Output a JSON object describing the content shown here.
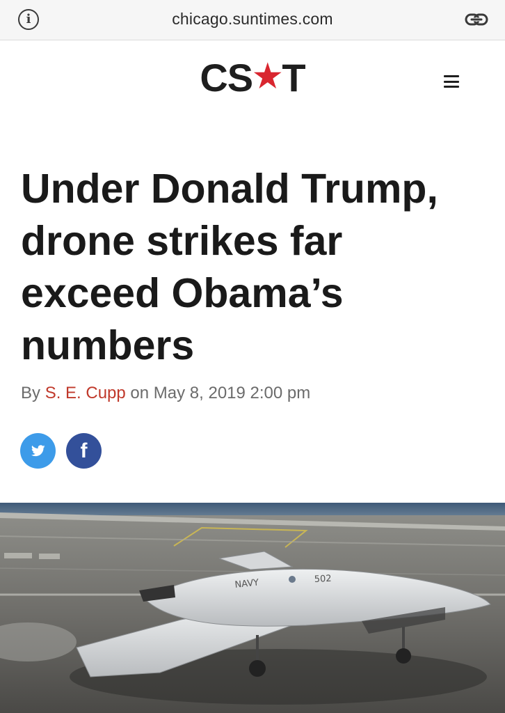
{
  "browser": {
    "url": "chicago.suntimes.com",
    "info_icon_glyph": "i",
    "info_icon": "info-circle-icon",
    "link_icon": "link-icon"
  },
  "masthead": {
    "logo_left": "CS",
    "logo_star": "★",
    "logo_right": "T",
    "logo_star_color": "#d9262f",
    "menu_icon": "hamburger-menu-icon"
  },
  "article": {
    "headline_lines": [
      "Under Donald Trump,",
      "drone strikes far",
      "exceed Obama’s",
      "numbers"
    ],
    "byline": {
      "prefix": "By ",
      "author": "S. E. Cupp",
      "middle": " on ",
      "date": "May 8, 2019 2:00 pm"
    },
    "author_color": "#c0392b"
  },
  "share": {
    "twitter_icon": "twitter-bird-icon",
    "twitter_color": "#3d9be9",
    "facebook_glyph": "f",
    "facebook_color": "#33509a"
  },
  "hero": {
    "drone_markings": [
      "NAVY",
      "502"
    ]
  }
}
